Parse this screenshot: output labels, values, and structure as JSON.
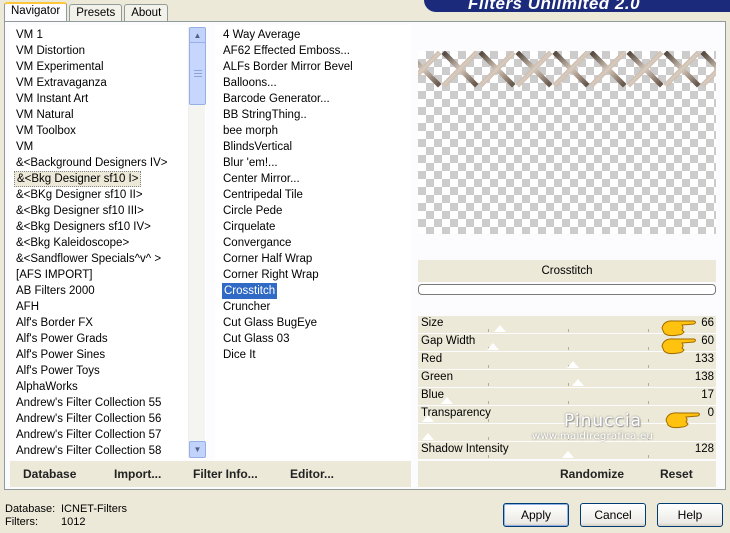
{
  "banner": {
    "title": "Filters Unlimited 2.0"
  },
  "tabs": [
    {
      "label": "Navigator",
      "active": true
    },
    {
      "label": "Presets",
      "active": false
    },
    {
      "label": "About",
      "active": false
    }
  ],
  "categories": [
    "VM 1",
    "VM Distortion",
    "VM Experimental",
    "VM Extravaganza",
    "VM Instant Art",
    "VM Natural",
    "VM Toolbox",
    "VM",
    "&<Background Designers IV>",
    "&<Bkg Designer sf10 I>",
    "&<BKg Designer sf10 II>",
    "&<Bkg Designer sf10 III>",
    "&<Bkg Designers sf10 IV>",
    "&<Bkg Kaleidoscope>",
    "&<Sandflower Specials^v^ >",
    "[AFS IMPORT]",
    "AB Filters 2000",
    "AFH",
    "Alf's Border FX",
    "Alf's Power Grads",
    "Alf's Power Sines",
    "Alf's Power Toys",
    "AlphaWorks",
    "Andrew's Filter Collection 55",
    "Andrew's Filter Collection 56",
    "Andrew's Filter Collection 57",
    "Andrew's Filter Collection 58"
  ],
  "selected_category_index": 9,
  "filters": [
    "4 Way Average",
    "AF62 Effected Emboss...",
    "ALFs Border Mirror Bevel",
    "Balloons...",
    "Barcode Generator...",
    "BB StringThing..",
    "bee morph",
    "BlindsVertical",
    "Blur 'em!...",
    "Center Mirror...",
    "Centripedal Tile",
    "Circle Pede",
    "Cirquelate",
    "Convergance",
    "Corner Half Wrap",
    "Corner Right Wrap",
    "Crosstitch",
    "Cruncher",
    "Cut Glass  BugEye",
    "Cut Glass 03",
    "Dice It"
  ],
  "selected_filter_index": 16,
  "filter_name": "Crosstitch",
  "params": [
    {
      "label": "Size",
      "value": "66",
      "level": 66
    },
    {
      "label": "Gap Width",
      "value": "60",
      "level": 60
    },
    {
      "label": "Red",
      "value": "133",
      "level": 133
    },
    {
      "label": "Green",
      "value": "138",
      "level": 138
    },
    {
      "label": "Blue",
      "value": "17",
      "level": 17
    },
    {
      "label": "Transparency",
      "value": "0",
      "level": 0
    },
    {
      "label": "",
      "value": "",
      "level": 0
    },
    {
      "label": "Shadow Intensity",
      "value": "128",
      "level": 128
    }
  ],
  "watermark": {
    "name": "Pinuccia",
    "url": "www.maidiregrafica.eu"
  },
  "bottom_left_buttons": [
    {
      "label": "Database"
    },
    {
      "label": "Import..."
    },
    {
      "label": "Filter Info..."
    },
    {
      "label": "Editor..."
    }
  ],
  "bottom_right_buttons": [
    {
      "label": "Randomize"
    },
    {
      "label": "Reset"
    }
  ],
  "info": {
    "database_label": "Database:",
    "database_value": "ICNET-Filters",
    "filters_label": "Filters:",
    "filters_value": "1012"
  },
  "dialog_buttons": {
    "apply": "Apply",
    "cancel": "Cancel",
    "help": "Help"
  }
}
